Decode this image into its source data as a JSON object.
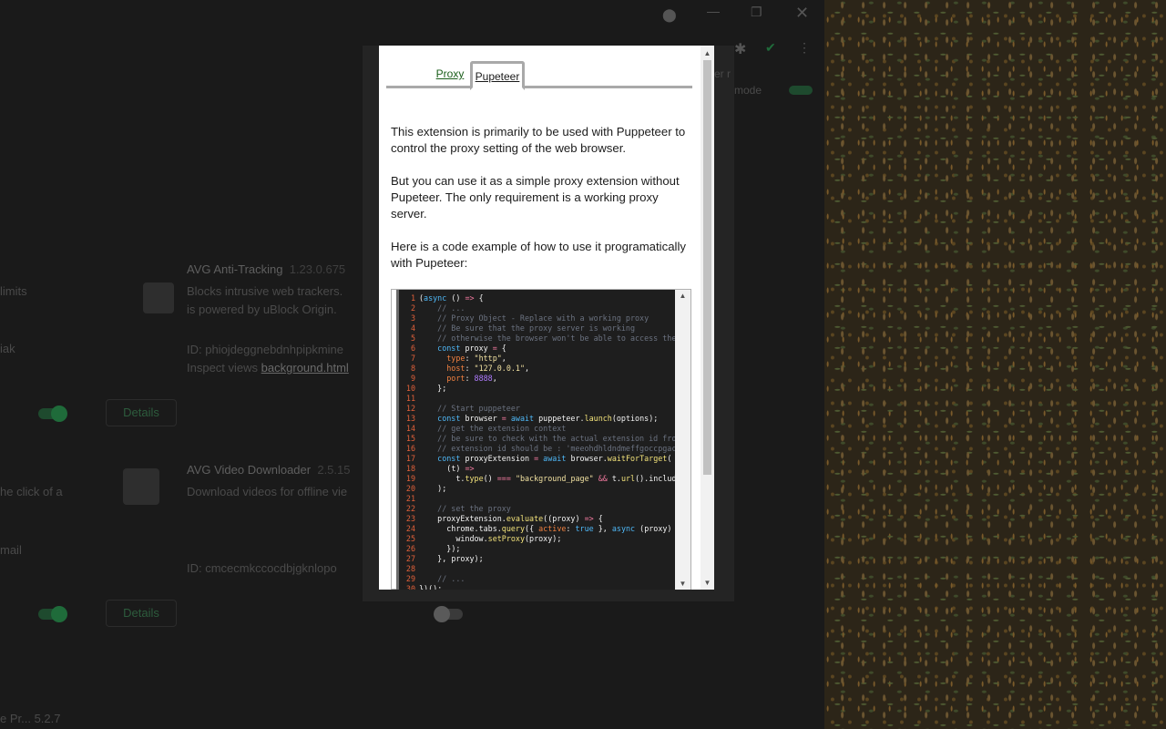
{
  "background": {
    "ext1": {
      "name": "AVG Anti-Tracking",
      "version": "1.23.0.675",
      "desc1": "Blocks intrusive web trackers. ",
      "desc2": "is powered by uBlock Origin.",
      "id": "ID: phiojdeggnebdnhpipkmine",
      "inspect": "Inspect views",
      "inspect_link": "background.html"
    },
    "ext2": {
      "name": "AVG Video Downloader",
      "version": "2.5.15",
      "desc": "Download videos for offline vie",
      "id": "ID: cmcecmkccocdbjgknlopo"
    },
    "left_texts": [
      "limits",
      "iak",
      "he click of a",
      "mail",
      "e Pr...  5.2.7"
    ],
    "details_label": "Details",
    "behind_popup": [
      "er r",
      "mode"
    ]
  },
  "popup": {
    "tabs": [
      {
        "label": "Proxy",
        "active": false
      },
      {
        "label": "Pupeteer",
        "active": true
      }
    ],
    "paragraphs": [
      "This extension is primarily to be used with Puppeteer to control the proxy setting of the web browser.",
      "But you can use it as a simple proxy extension without Pupeteer. The only requirement is a working proxy server.",
      "Here is a code example of how to use it programatically with Pupeteer:"
    ],
    "code_lines": [
      "(async () => {",
      "    // ...",
      "    // Proxy Object - Replace with a working proxy",
      "    // Be sure that the proxy server is working",
      "    // otherwise the browser won't be able to access the",
      "    const proxy = {",
      "      type: \"http\",",
      "      host: \"127.0.0.1\",",
      "      port: 8888,",
      "    };",
      "",
      "    // Start puppeteer",
      "    const browser = await puppeteer.launch(options);",
      "    // get the extension context",
      "    // be sure to check with the actual extension id from",
      "    // extension id should be : 'meeohdhldndmeffgoccpgacf",
      "    const proxyExtension = await browser.waitForTarget(",
      "      (t) =>",
      "        t.type() === \"background_page\" && t.url().include",
      "    );",
      "",
      "    // set the proxy",
      "    proxyExtension.evaluate((proxy) => {",
      "      chrome.tabs.query({ active: true }, async (proxy) =",
      "        window.setProxy(proxy);",
      "      });",
      "    }, proxy);",
      "",
      "    // ...",
      "})();"
    ]
  }
}
